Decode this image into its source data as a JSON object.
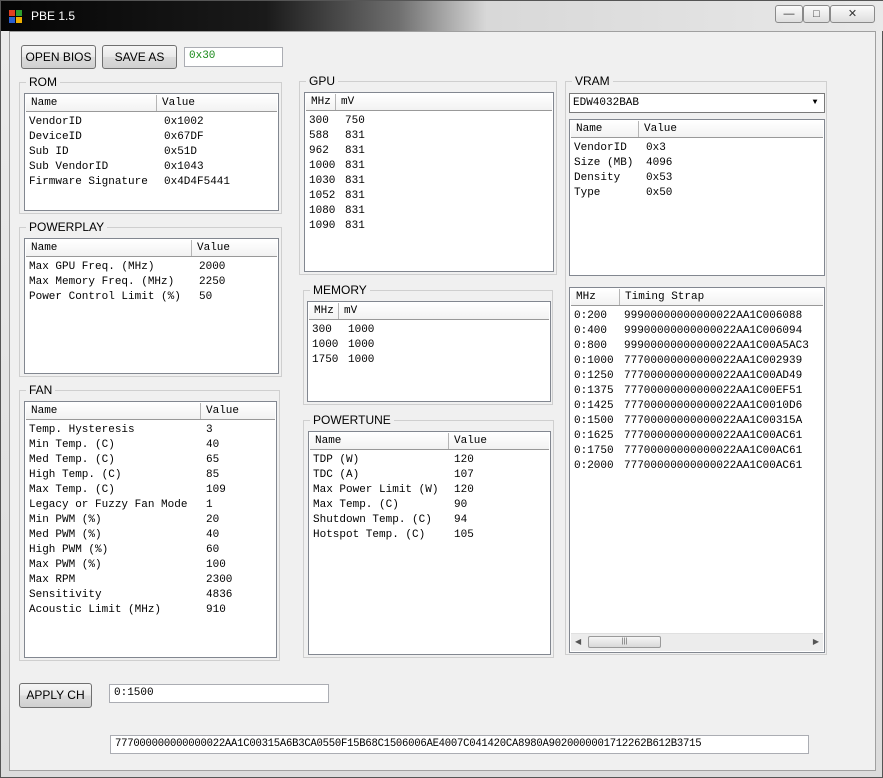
{
  "window": {
    "title": "PBE 1.5",
    "minimize": "—",
    "maximize": "□",
    "close": "✕"
  },
  "toolbar": {
    "open_label": "OPEN BIOS",
    "save_label": "SAVE AS",
    "offset_value": "0x30"
  },
  "rom": {
    "title": "ROM",
    "headers": [
      "Name",
      "Value"
    ],
    "rows": [
      [
        "VendorID",
        "0x1002"
      ],
      [
        "DeviceID",
        "0x67DF"
      ],
      [
        "Sub ID",
        "0x51D"
      ],
      [
        "Sub VendorID",
        "0x1043"
      ],
      [
        "Firmware Signature",
        "0x4D4F5441"
      ]
    ]
  },
  "powerplay": {
    "title": "POWERPLAY",
    "headers": [
      "Name",
      "Value"
    ],
    "rows": [
      [
        "Max GPU Freq. (MHz)",
        "2000"
      ],
      [
        "Max Memory Freq. (MHz)",
        "2250"
      ],
      [
        "Power Control Limit (%)",
        "50"
      ]
    ]
  },
  "fan": {
    "title": "FAN",
    "headers": [
      "Name",
      "Value"
    ],
    "rows": [
      [
        "Temp. Hysteresis",
        "3"
      ],
      [
        "Min Temp. (C)",
        "40"
      ],
      [
        "Med Temp. (C)",
        "65"
      ],
      [
        "High Temp. (C)",
        "85"
      ],
      [
        "Max Temp. (C)",
        "109"
      ],
      [
        "Legacy or Fuzzy Fan Mode",
        "1"
      ],
      [
        "Min PWM (%)",
        "20"
      ],
      [
        "Med PWM (%)",
        "40"
      ],
      [
        "High PWM (%)",
        "60"
      ],
      [
        "Max PWM (%)",
        "100"
      ],
      [
        "Max RPM",
        "2300"
      ],
      [
        "Sensitivity",
        "4836"
      ],
      [
        "Acoustic Limit (MHz)",
        "910"
      ]
    ]
  },
  "gpu": {
    "title": "GPU",
    "headers": [
      "MHz",
      "mV"
    ],
    "rows": [
      [
        "300",
        "750"
      ],
      [
        "588",
        "831"
      ],
      [
        "962",
        "831"
      ],
      [
        "1000",
        "831"
      ],
      [
        "1030",
        "831"
      ],
      [
        "1052",
        "831"
      ],
      [
        "1080",
        "831"
      ],
      [
        "1090",
        "831"
      ]
    ]
  },
  "memory": {
    "title": "MEMORY",
    "headers": [
      "MHz",
      "mV"
    ],
    "rows": [
      [
        "300",
        "1000"
      ],
      [
        "1000",
        "1000"
      ],
      [
        "1750",
        "1000"
      ]
    ]
  },
  "powertune": {
    "title": "POWERTUNE",
    "headers": [
      "Name",
      "Value"
    ],
    "rows": [
      [
        "TDP (W)",
        "120"
      ],
      [
        "TDC (A)",
        "107"
      ],
      [
        "Max Power Limit (W)",
        "120"
      ],
      [
        "Max Temp. (C)",
        "90"
      ],
      [
        "Shutdown Temp. (C)",
        "94"
      ],
      [
        "Hotspot Temp. (C)",
        "105"
      ]
    ]
  },
  "vram": {
    "title": "VRAM",
    "selected": "EDW4032BAB",
    "headers": [
      "Name",
      "Value"
    ],
    "rows": [
      [
        "VendorID",
        "0x3"
      ],
      [
        "Size (MB)",
        "4096"
      ],
      [
        "Density",
        "0x53"
      ],
      [
        "Type",
        "0x50"
      ]
    ],
    "timing_headers": [
      "MHz",
      "Timing Strap"
    ],
    "timings": [
      [
        "0:200",
        "99900000000000022AA1C006088"
      ],
      [
        "0:400",
        "99900000000000022AA1C006094"
      ],
      [
        "0:800",
        "99900000000000022AA1C00A5AC3"
      ],
      [
        "0:1000",
        "77700000000000022AA1C002939"
      ],
      [
        "0:1250",
        "77700000000000022AA1C00AD49"
      ],
      [
        "0:1375",
        "77700000000000022AA1C00EF51"
      ],
      [
        "0:1425",
        "77700000000000022AA1C0010D6"
      ],
      [
        "0:1500",
        "77700000000000022AA1C00315A"
      ],
      [
        "0:1625",
        "77700000000000022AA1C00AC61"
      ],
      [
        "0:1750",
        "77700000000000022AA1C00AC61"
      ],
      [
        "0:2000",
        "77700000000000022AA1C00AC61"
      ]
    ]
  },
  "apply": {
    "label": "APPLY CH",
    "mhz_value": "0:1500",
    "strap_value": "777000000000000022AA1C00315A6B3CA0550F15B68C1506006AE4007C041420CA8980A9020000001712262B612B3715"
  },
  "colors": {
    "offset_text": "#1a8a1a"
  }
}
